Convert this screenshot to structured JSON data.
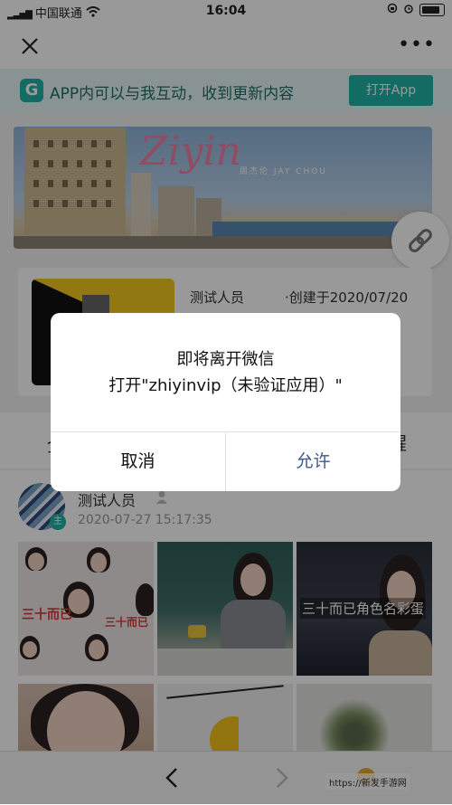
{
  "status_bar": {
    "carrier": "中国联通",
    "time": "16:04"
  },
  "app_banner": {
    "logo_letter": "G",
    "text": "APP内可以与我互动，收到更新内容",
    "open_button": "打开App"
  },
  "hero": {
    "brand_text": "Ziyin",
    "brand_sub": "周杰伦  JAY CHOU"
  },
  "post": {
    "author": "测试人员",
    "created": "·创建于2020/07/20"
  },
  "tabs": {
    "left_peek": "全",
    "right_peek": "醒"
  },
  "comment": {
    "name": "测试人员",
    "date": "2020-07-27 15:17:35",
    "avatar_badge": "主"
  },
  "gallery": {
    "drama_text_1": "三十而已",
    "drama_caption": "三十而已角色名彩蛋"
  },
  "watermark": "https://新发手游网",
  "dialog": {
    "title": "即将离开微信",
    "message": "打开\"zhiyinvip（未验证应用）\"",
    "cancel": "取消",
    "allow": "允许"
  },
  "colors": {
    "accent": "#1fb5a6",
    "allow_text": "#3d5a8e"
  }
}
